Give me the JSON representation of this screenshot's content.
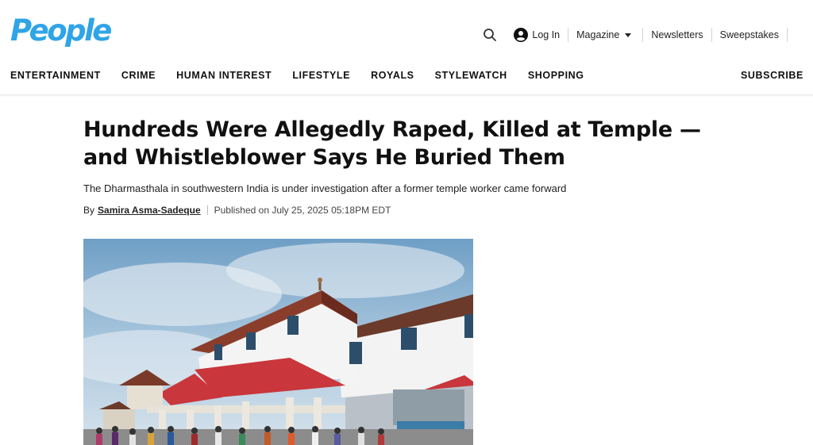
{
  "brand": {
    "logo": "People",
    "accent": "#2fa4e7"
  },
  "top_bar": {
    "search_icon": "search-icon",
    "login_label": "Log In",
    "magazine_label": "Magazine",
    "newsletters_label": "Newsletters",
    "sweepstakes_label": "Sweepstakes"
  },
  "nav": {
    "items": [
      "ENTERTAINMENT",
      "CRIME",
      "HUMAN INTEREST",
      "LIFESTYLE",
      "ROYALS",
      "STYLEWATCH",
      "SHOPPING"
    ],
    "subscribe_label": "SUBSCRIBE"
  },
  "article": {
    "headline": "Hundreds Were Allegedly Raped, Killed at Temple — and Whistleblower Says He Buried Them",
    "dek": "The Dharmasthala in southwestern India is under investigation after a former temple worker came forward",
    "by_prefix": "By",
    "author": "Samira Asma-Sadeque",
    "published": "Published on July 25, 2025 05:18PM EDT"
  }
}
